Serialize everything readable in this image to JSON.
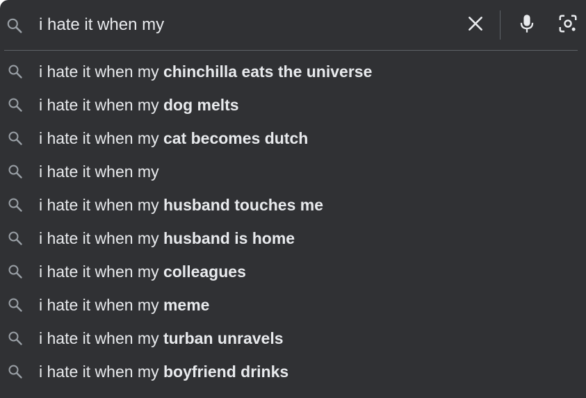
{
  "search": {
    "query": "i hate it when my",
    "icons": {
      "search": "search-icon",
      "clear": "close-icon",
      "voice": "microphone-icon",
      "lens": "camera-lens-icon"
    }
  },
  "colors": {
    "background": "#303134",
    "text": "#e8eaed",
    "icon": "#9aa0a6",
    "divider": "#5f6368"
  },
  "suggestions": [
    {
      "prefix": "i hate it when my ",
      "completion": "chinchilla eats the universe"
    },
    {
      "prefix": "i hate it when my ",
      "completion": "dog melts"
    },
    {
      "prefix": "i hate it when my ",
      "completion": "cat becomes dutch"
    },
    {
      "prefix": "i hate it when my",
      "completion": ""
    },
    {
      "prefix": "i hate it when my ",
      "completion": "husband touches me"
    },
    {
      "prefix": "i hate it when my ",
      "completion": "husband is home"
    },
    {
      "prefix": "i hate it when my ",
      "completion": "colleagues"
    },
    {
      "prefix": "i hate it when my ",
      "completion": "meme"
    },
    {
      "prefix": "i hate it when my ",
      "completion": "turban unravels"
    },
    {
      "prefix": "i hate it when my ",
      "completion": "boyfriend drinks"
    }
  ]
}
